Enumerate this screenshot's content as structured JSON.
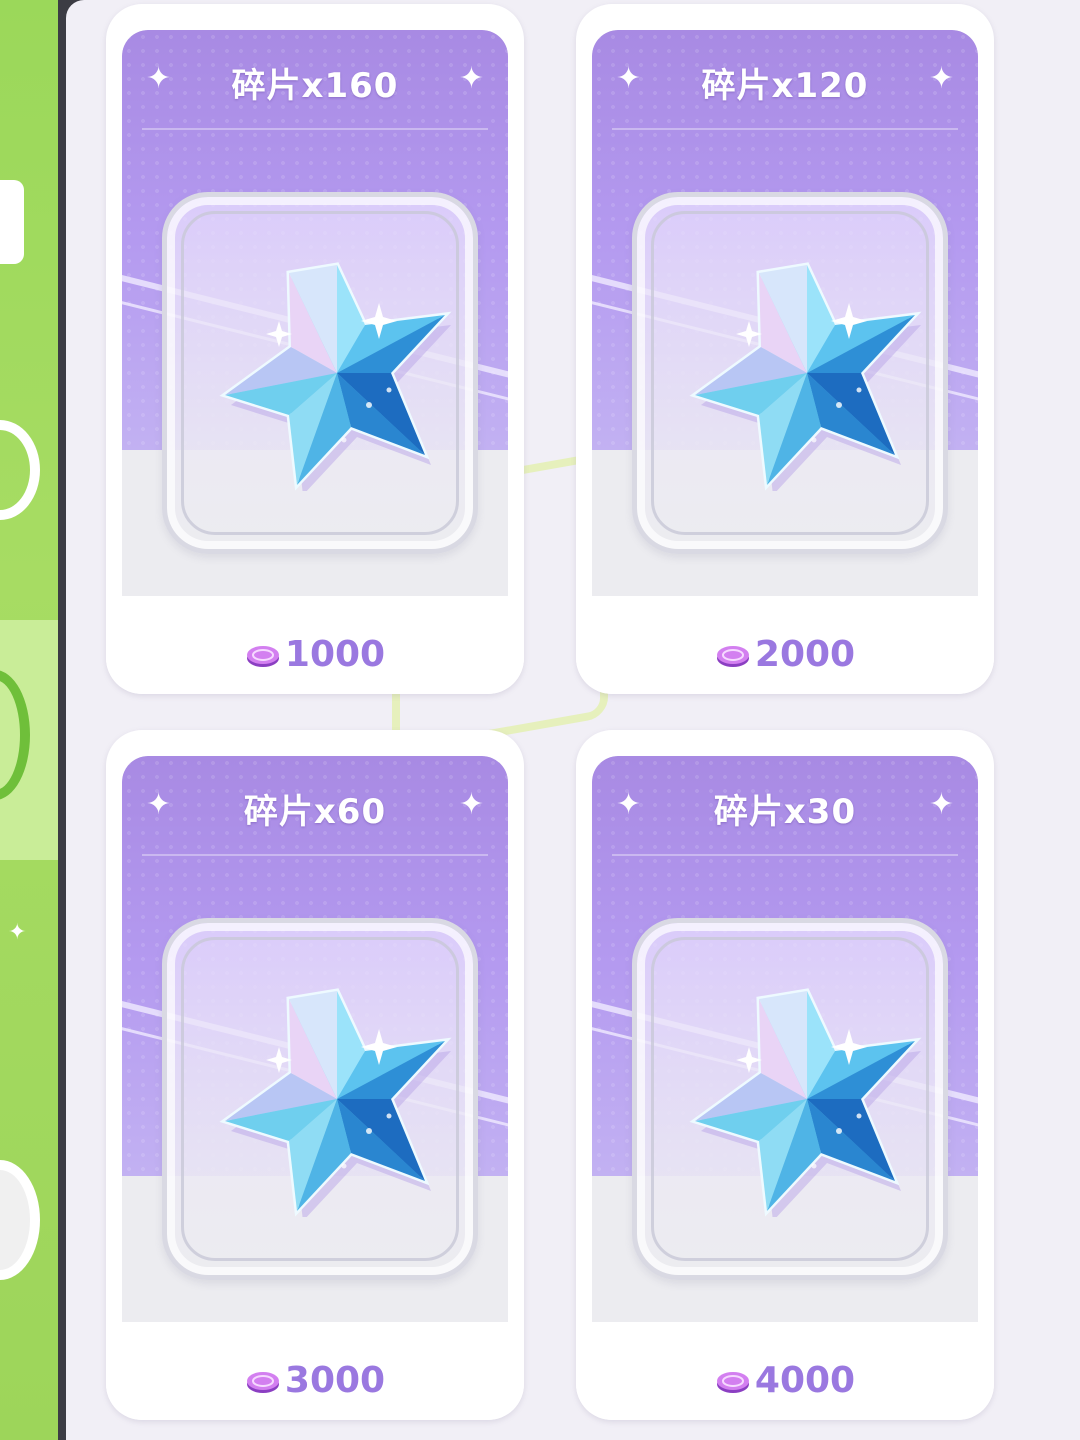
{
  "shop": {
    "items": [
      {
        "title": "碎片x160",
        "price": "1000"
      },
      {
        "title": "碎片x120",
        "price": "2000"
      },
      {
        "title": "碎片x60",
        "price": "3000"
      },
      {
        "title": "碎片x30",
        "price": "4000"
      }
    ]
  },
  "colors": {
    "header_purple": "#a88ae3",
    "price_purple": "#9a78e0",
    "sidebar_green": "#9bd85a"
  },
  "icons": {
    "item": "crystal-star-icon",
    "currency": "purple-coin-icon",
    "decoration": "sparkle-icon"
  }
}
